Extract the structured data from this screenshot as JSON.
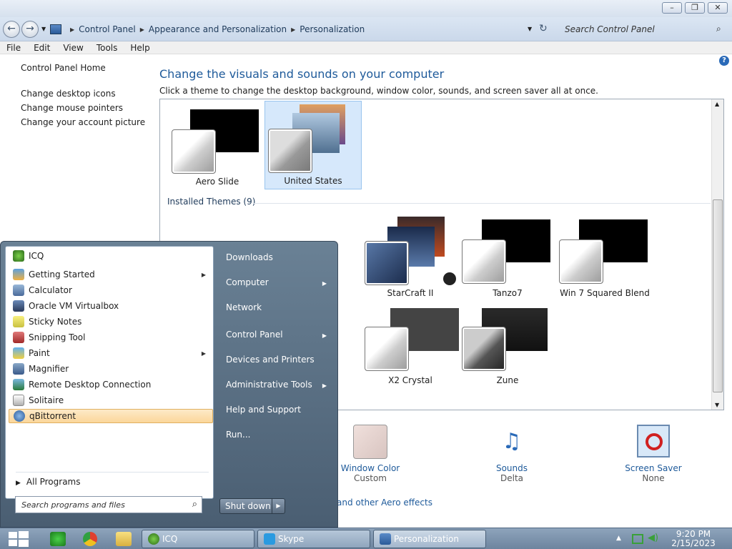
{
  "window": {
    "breadcrumb": [
      "Control Panel",
      "Appearance and Personalization",
      "Personalization"
    ],
    "search_placeholder": "Search Control Panel",
    "menu": [
      "File",
      "Edit",
      "View",
      "Tools",
      "Help"
    ]
  },
  "leftnav": {
    "home": "Control Panel Home",
    "links": [
      "Change desktop icons",
      "Change mouse pointers",
      "Change your account picture"
    ]
  },
  "main": {
    "heading": "Change the visuals and sounds on your computer",
    "subtext": "Click a theme to change the desktop background, window color, sounds, and screen saver all at once.",
    "my_themes": [
      "Aero Slide",
      "United States"
    ],
    "installed_header": "Installed Themes (9)",
    "installed_themes": [
      "StarCraft II",
      "Tanzo7",
      "Win 7 Squared Blend",
      "X2 Crystal",
      "Zune"
    ],
    "bottom": {
      "window_color": {
        "title": "Window Color",
        "value": "Custom"
      },
      "sounds": {
        "title": "Sounds",
        "value": "Delta"
      },
      "screen_saver": {
        "title": "Screen Saver",
        "value": "None"
      },
      "aero_link": "and other Aero effects"
    }
  },
  "start_menu": {
    "programs": [
      "ICQ",
      "Getting Started",
      "Calculator",
      "Oracle VM Virtualbox",
      "Sticky Notes",
      "Snipping Tool",
      "Paint",
      "Magnifier",
      "Remote Desktop Connection",
      "Solitaire",
      "qBittorrent"
    ],
    "all_programs": "All Programs",
    "search_placeholder": "Search programs and files",
    "right": [
      "Downloads",
      "Computer",
      "Network",
      "Control Panel",
      "Devices and Printers",
      "Administrative Tools",
      "Help and Support",
      "Run..."
    ],
    "shutdown": "Shut down"
  },
  "taskbar": {
    "buttons": [
      "ICQ",
      "Skype",
      "Personalization"
    ],
    "time": "9:20 PM",
    "date": "2/15/2023"
  },
  "colors": {
    "link": "#1e5a9a",
    "highlight": "#fbd69a",
    "selected_theme": "#d6e8fb"
  }
}
